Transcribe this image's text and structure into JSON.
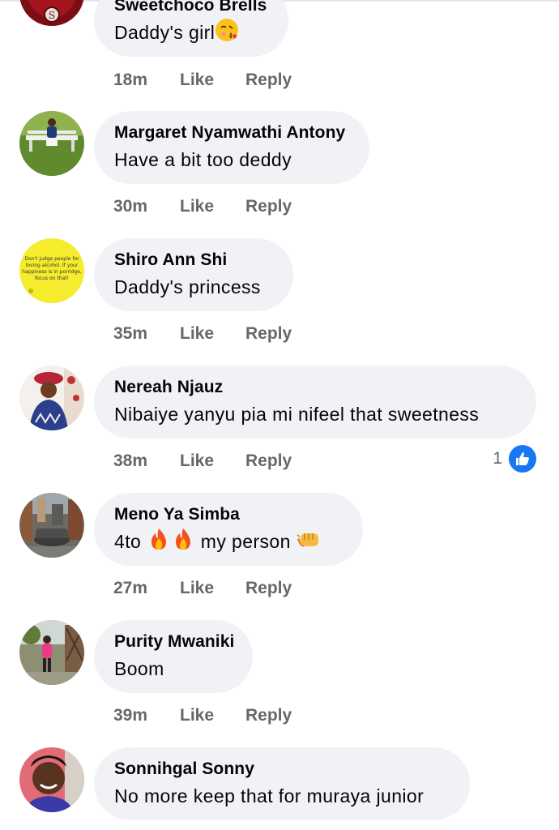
{
  "comments": [
    {
      "author": "Sweetchoco Brells",
      "text": "Daddy's girl",
      "time": "18m",
      "like": "Like",
      "reply": "Reply",
      "emoji": "face-blowing-kiss-icon"
    },
    {
      "author": "Margaret Nyamwathi Antony",
      "text": "Have a bit too deddy",
      "time": "30m",
      "like": "Like",
      "reply": "Reply"
    },
    {
      "author": "Shiro Ann Shi",
      "text": "Daddy's princess",
      "time": "35m",
      "like": "Like",
      "reply": "Reply",
      "avatar_text": "Don't judge people for loving alcohol. If your happiness is in porridge, focus on that!"
    },
    {
      "author": "Nereah Njauz",
      "text": "Nibaiye yanyu pia mi nifeel  that sweetness",
      "time": "38m",
      "like": "Like",
      "reply": "Reply",
      "reaction_count": "1",
      "reaction_icon": "like-thumb-icon"
    },
    {
      "author": "Meno Ya Simba",
      "text_before": "4to",
      "text_after": "my person",
      "time": "27m",
      "like": "Like",
      "reply": "Reply",
      "emojis": [
        "fire-icon",
        "fire-icon",
        "oncoming-fist-icon"
      ]
    },
    {
      "author": "Purity Mwaniki",
      "text": "Boom",
      "time": "39m",
      "like": "Like",
      "reply": "Reply"
    },
    {
      "author": "Sonnihgal Sonny",
      "text": "No more keep that for muraya junior",
      "time": "",
      "like": "",
      "reply": ""
    }
  ],
  "colors": {
    "bubble": "#f0f2f5",
    "meta": "#65676b",
    "like_blue": "#1877f2",
    "text": "#050505"
  }
}
